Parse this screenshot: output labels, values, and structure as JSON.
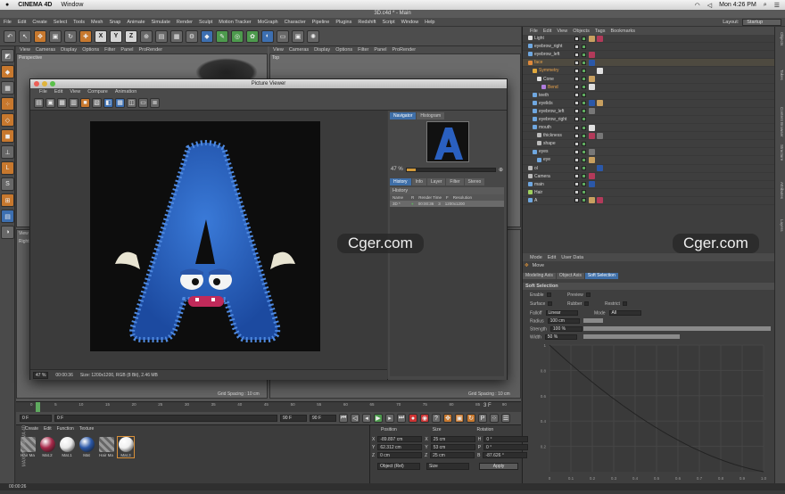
{
  "mac_menu": {
    "app": "CINEMA 4D",
    "window": "Window",
    "clock": "Mon 4:26 PM"
  },
  "title": "3D.c4d * - Main",
  "menubar": {
    "items": [
      "File",
      "Edit",
      "Create",
      "Select",
      "Tools",
      "Mesh",
      "Snap",
      "Animate",
      "Simulate",
      "Render",
      "Sculpt",
      "Motion Tracker",
      "MoGraph",
      "Character",
      "Pipeline",
      "Plugins",
      "Redshift",
      "Script",
      "Window",
      "Help"
    ],
    "layout_label": "Layout:",
    "layout_value": "Startup"
  },
  "toolbar": {
    "axis_x": "X",
    "axis_y": "Y",
    "axis_z": "Z"
  },
  "viewport": {
    "menu_left": [
      "View",
      "Cameras",
      "Display",
      "Options",
      "Filter",
      "Panel",
      "ProRender"
    ],
    "menu_right": [
      "View",
      "Cameras",
      "Display",
      "Options",
      "Filter",
      "Panel",
      "ProRender"
    ],
    "label_perspective": "Perspective",
    "label_top": "Top",
    "label_right": "Right",
    "label_view": "View",
    "grid_left": "Grid Spacing : 10 cm",
    "grid_right": "Grid Spacing : 10 cm"
  },
  "picture_viewer": {
    "title": "Picture Viewer",
    "menu": [
      "File",
      "Edit",
      "View",
      "Compare",
      "Animation"
    ],
    "zoom": "47 %",
    "time": "00:00:36",
    "size_info": "Size: 1200x1200, RGB (8 Bit), 2.46 MB",
    "tabs_top": [
      "Navigator",
      "Histogram"
    ],
    "nav_zoom": "47 %",
    "tabs_bottom": [
      "History",
      "Info",
      "Layer",
      "Filter",
      "Stereo"
    ],
    "history_title": "History",
    "history_cols": [
      "Name",
      "R",
      "Render Time",
      "F",
      "Resolution"
    ],
    "history_row": {
      "name": "3D *",
      "render_time": "00:00:36",
      "frame": "3",
      "resolution": "1200x1200"
    }
  },
  "object_manager": {
    "menu": [
      "File",
      "Edit",
      "View",
      "Objects",
      "Tags",
      "Bookmarks"
    ],
    "objects": [
      {
        "name": "Light",
        "indent": 0,
        "color": "#e0e0e0"
      },
      {
        "name": "eyebrow_right",
        "indent": 0,
        "color": "#6fa7e0"
      },
      {
        "name": "eyebrow_left",
        "indent": 0,
        "color": "#6fa7e0"
      },
      {
        "name": "face",
        "indent": 0,
        "color": "#e08a3c"
      },
      {
        "name": "Symmetry",
        "indent": 1,
        "color": "#e0a83c"
      },
      {
        "name": "Cone",
        "indent": 2,
        "color": "#e0e0e0"
      },
      {
        "name": "Bend",
        "indent": 3,
        "color": "#b07cdd"
      },
      {
        "name": "teeth",
        "indent": 1,
        "color": "#6fa7e0"
      },
      {
        "name": "eyelids",
        "indent": 1,
        "color": "#6fa7e0"
      },
      {
        "name": "eyebrow_left",
        "indent": 1,
        "color": "#6fa7e0"
      },
      {
        "name": "eyebrow_right",
        "indent": 1,
        "color": "#6fa7e0"
      },
      {
        "name": "mouth",
        "indent": 1,
        "color": "#6fa7e0"
      },
      {
        "name": "thickness",
        "indent": 2,
        "color": "#bbb"
      },
      {
        "name": "shape",
        "indent": 2,
        "color": "#bbb"
      },
      {
        "name": "eyes",
        "indent": 1,
        "color": "#6fa7e0"
      },
      {
        "name": "eye",
        "indent": 2,
        "color": "#6fa7e0"
      },
      {
        "name": "ol",
        "indent": 0,
        "color": "#bbb"
      },
      {
        "name": "Camera",
        "indent": 0,
        "color": "#bbb"
      },
      {
        "name": "main",
        "indent": 0,
        "color": "#6fa7e0"
      },
      {
        "name": "Hair",
        "indent": 0,
        "color": "#9fd05f"
      },
      {
        "name": "A",
        "indent": 0,
        "color": "#6fa7e0"
      }
    ]
  },
  "attribute_manager": {
    "menu": [
      "Mode",
      "Edit",
      "User Data"
    ],
    "tool": "Move",
    "tabs": [
      "Modeling Axis",
      "Object Axis",
      "Soft Selection"
    ],
    "section": "Soft Selection",
    "rows": [
      {
        "label": "Enable",
        "value": ""
      },
      {
        "label": "Preview",
        "value": ""
      },
      {
        "label": "Surface",
        "value": ""
      },
      {
        "label": "Rubber",
        "value": ""
      },
      {
        "label": "Restrict",
        "value": ""
      },
      {
        "label": "Falloff",
        "value": "Linear"
      },
      {
        "label": "Mode",
        "value": "All"
      },
      {
        "label": "Radius",
        "value": "100 cm"
      },
      {
        "label": "Strength",
        "value": "100 %"
      },
      {
        "label": "Width",
        "value": "50 %"
      }
    ],
    "graph_y": [
      "1",
      "0.8",
      "0.6",
      "0.4",
      "0.2"
    ],
    "graph_x": [
      "0",
      "0.1",
      "0.2",
      "0.3",
      "0.4",
      "0.5",
      "0.6",
      "0.7",
      "0.8",
      "0.9",
      "1.0"
    ]
  },
  "right_strip": [
    "Objects",
    "Takes",
    "Content Browser",
    "Structure",
    "Attributes",
    "Layers"
  ],
  "timeline": {
    "marks": [
      "0",
      "5",
      "10",
      "15",
      "20",
      "25",
      "30",
      "35",
      "40",
      "45",
      "50",
      "55",
      "60",
      "65",
      "70",
      "75",
      "80",
      "85",
      "90"
    ],
    "current_frame": "3 F"
  },
  "playback": {
    "start": "0 F",
    "current": "0 F",
    "end": "90 F",
    "end2": "90 F"
  },
  "material_manager": {
    "menu": [
      "Create",
      "Edit",
      "Function",
      "Texture"
    ],
    "materials": [
      {
        "name": "Hair Ma",
        "color": "#888"
      },
      {
        "name": "Mat.2",
        "color": "#a8294a"
      },
      {
        "name": "Mat.1",
        "color": "#e8e8e8"
      },
      {
        "name": "Mat",
        "color": "#2b58a8"
      },
      {
        "name": "Hair Ma",
        "color": "#888"
      },
      {
        "name": "Mat.3",
        "color": "#f0f0f0"
      }
    ]
  },
  "coordinates": {
    "headers": [
      "Position",
      "Size",
      "Rotation"
    ],
    "rows": [
      {
        "axis": "X",
        "pos": "-89.897 cm",
        "size": "25 cm",
        "rot_label": "H",
        "rot": "0 °"
      },
      {
        "axis": "Y",
        "pos": "62.312 cm",
        "size": "53 cm",
        "rot_label": "P",
        "rot": "0 °"
      },
      {
        "axis": "Z",
        "pos": "0 cm",
        "size": "25 cm",
        "rot_label": "B",
        "rot": "-87.626 °"
      }
    ],
    "mode": "Object (Rel)",
    "size_mode": "Size",
    "apply": "Apply"
  },
  "status_time": "00:00:26",
  "brand": "MAXON CINEMA 4D",
  "watermark": "Cger.com"
}
